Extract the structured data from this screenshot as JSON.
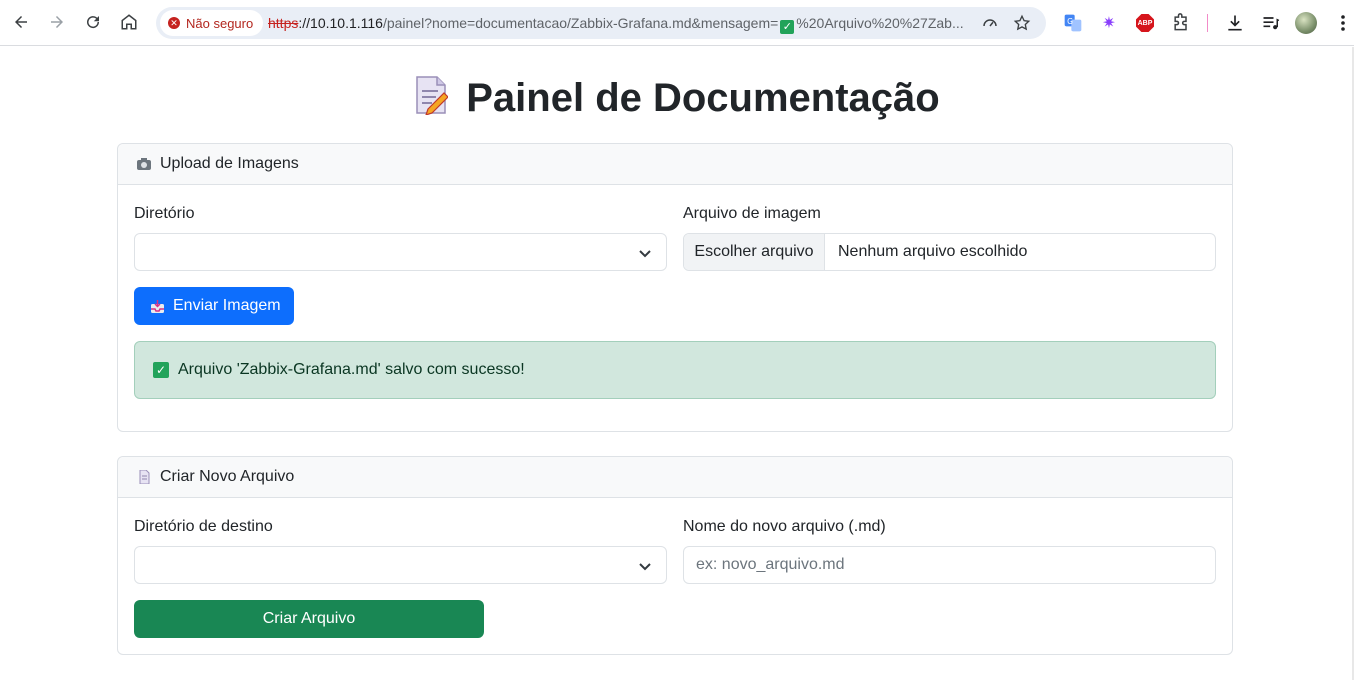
{
  "browser": {
    "security_label": "Não seguro",
    "url_scheme": "https",
    "url_host": "://10.10.1.116",
    "url_rest": "/painel?nome=documentacao/Zabbix-Grafana.md&mensagem=",
    "url_tail": "%20Arquivo%20%27Zab...",
    "abp_label": "ABP"
  },
  "page": {
    "title": "Painel de Documentação"
  },
  "upload": {
    "header": "Upload de Imagens",
    "dir_label": "Diretório",
    "dir_value": "",
    "file_label": "Arquivo de imagem",
    "choose_label": "Escolher arquivo",
    "no_file_label": "Nenhum arquivo escolhido",
    "submit_label": "Enviar Imagem",
    "alert_message": "Arquivo 'Zabbix-Grafana.md' salvo com sucesso!"
  },
  "create": {
    "header": "Criar Novo Arquivo",
    "dir_label": "Diretório de destino",
    "dir_value": "",
    "name_label": "Nome do novo arquivo (.md)",
    "name_placeholder": "ex: novo_arquivo.md",
    "submit_label": "Criar Arquivo"
  },
  "colors": {
    "primary": "#0d6efd",
    "success": "#198754",
    "alert_bg": "#d1e7dd",
    "insecure": "#c5221f"
  }
}
